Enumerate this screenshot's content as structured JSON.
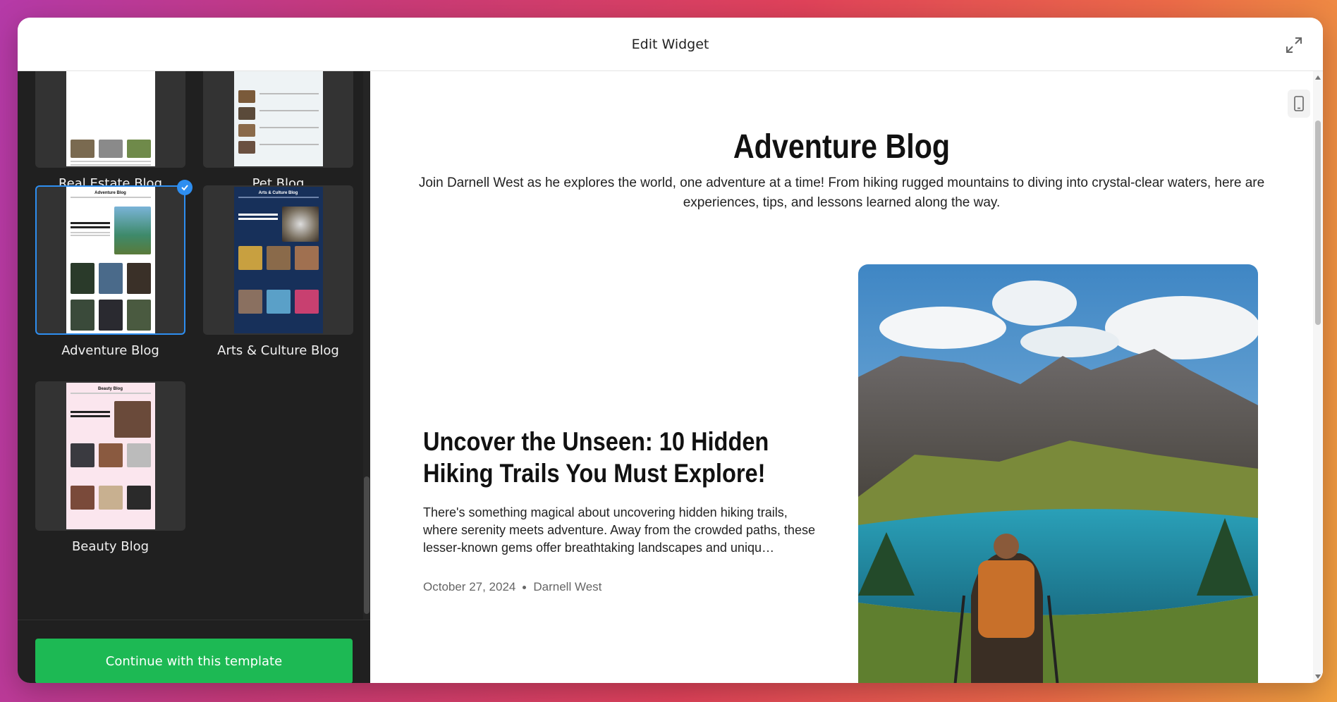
{
  "header": {
    "title": "Edit Widget"
  },
  "sidebar": {
    "templates": [
      {
        "label": "Real Estate Blog",
        "selected": false
      },
      {
        "label": "Pet Blog",
        "selected": false
      },
      {
        "label": "Adventure Blog",
        "selected": true
      },
      {
        "label": "Arts & Culture Blog",
        "selected": false
      },
      {
        "label": "Beauty Blog",
        "selected": false
      }
    ],
    "thumbs": {
      "adventure": "Adventure Blog",
      "arts": "Arts & Culture Blog",
      "beauty": "Beauty Blog"
    },
    "continue_label": "Continue with this template"
  },
  "preview": {
    "blog_title": "Adventure Blog",
    "blog_description": "Join Darnell West as he explores the world, one adventure at a time! From hiking rugged mountains to diving into crystal-clear waters, here are experiences, tips, and lessons learned along the way.",
    "post": {
      "title": "Uncover the Unseen: 10 Hidden Hiking Trails You Must Explore!",
      "excerpt": "There's something magical about uncovering hidden hiking trails, where serenity meets adventure. Away from the crowded paths, these lesser-known gems offer breathtaking landscapes and uniqu…",
      "date": "October 27, 2024",
      "author": "Darnell West"
    }
  },
  "colors": {
    "accent": "#2e8ef0",
    "continue": "#1db954",
    "sidebar_bg": "#202020"
  },
  "icons": {
    "expand": "expand-icon",
    "check": "check-icon",
    "mobile": "mobile-device-icon"
  }
}
